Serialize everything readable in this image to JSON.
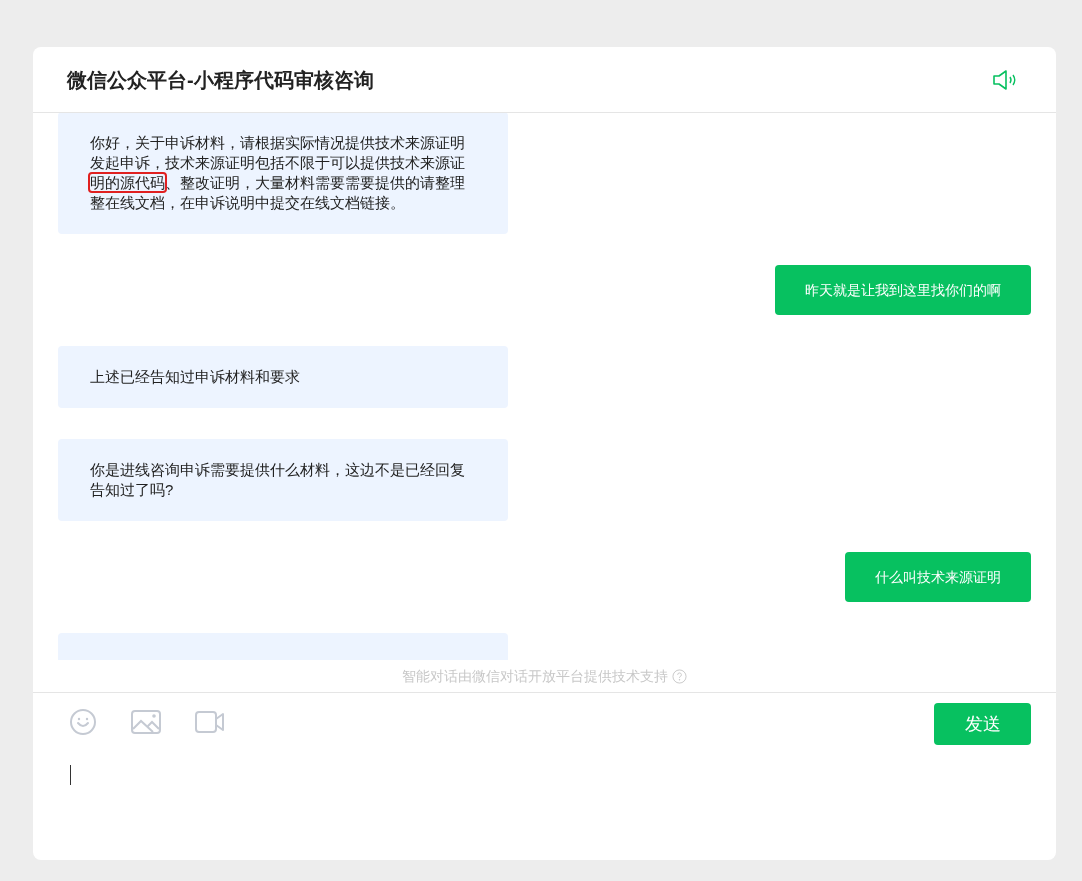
{
  "header": {
    "title": "微信公众平台-小程序代码审核咨询"
  },
  "messages": [
    {
      "kind": "received",
      "segments": [
        {
          "kind": "plain",
          "text": "你好，关于申诉材料，请根据实际情况提供技术来源证明发起申诉，技术来源证明包括不限于可以提供技术来源证"
        },
        {
          "kind": "boxed",
          "text": "明的源代码"
        },
        {
          "kind": "plain",
          "text": "、整改证明，大量材料需要需要提供的请整理整在线文档，在申诉说明中提交在线文档链接。"
        }
      ]
    },
    {
      "kind": "sent",
      "segments": [
        {
          "kind": "plain",
          "text": "昨天就是让我到这里找你们的啊"
        }
      ]
    },
    {
      "kind": "received",
      "segments": [
        {
          "kind": "plain",
          "text": "上述已经告知过申诉材料和要求"
        }
      ]
    },
    {
      "kind": "received",
      "segments": [
        {
          "kind": "plain",
          "text": "你是进线咨询申诉需要提供什么材料，这边不是已经回复告知过了吗?"
        }
      ]
    },
    {
      "kind": "sent",
      "segments": [
        {
          "kind": "plain",
          "text": "什么叫技术来源证明"
        }
      ]
    },
    {
      "kind": "received"
    }
  ],
  "notice": "智能对话由微信对话开放平台提供技术支持",
  "composer": {
    "send_button": "发送"
  }
}
